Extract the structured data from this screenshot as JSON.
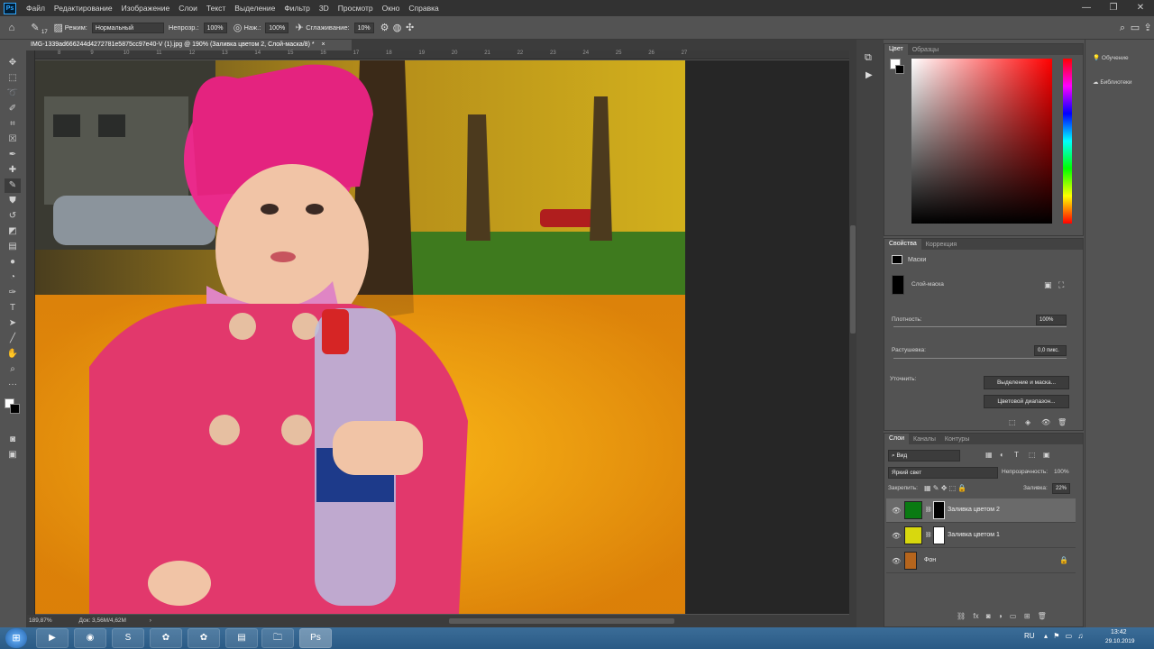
{
  "menubar": {
    "logo": "Ps",
    "items": [
      "Файл",
      "Редактирование",
      "Изображение",
      "Слои",
      "Текст",
      "Выделение",
      "Фильтр",
      "3D",
      "Просмотр",
      "Окно",
      "Справка"
    ]
  },
  "options": {
    "brush_size": "17",
    "mode_label": "Режим:",
    "mode_value": "Нормальный",
    "opacity_label": "Непрозр.:",
    "opacity_value": "100%",
    "pressure_label": "Наж.:",
    "pressure_value": "100%",
    "smoothing_label": "Сглаживание:",
    "smoothing_value": "10%"
  },
  "document": {
    "tab_title": "IMG-1339ad666244d4272781e5875cc97e40-V (1).jpg @ 190% (Заливка цветом 2, Слой-маска/8) *",
    "ruler_ticks": [
      "8",
      "9",
      "10",
      "11",
      "12",
      "13",
      "14",
      "15",
      "16",
      "17",
      "18",
      "19",
      "20",
      "21",
      "22",
      "23",
      "24",
      "25",
      "26",
      "27"
    ],
    "zoom": "189,87%",
    "doc_size": "Док: 3,56M/4,62M"
  },
  "color_panel": {
    "tabs": [
      "Цвет",
      "Образцы"
    ]
  },
  "properties_panel": {
    "tabs": [
      "Свойства",
      "Коррекция"
    ],
    "masks_label": "Маски",
    "layer_mask_label": "Слой-маска",
    "density_label": "Плотность:",
    "density_value": "100%",
    "feather_label": "Растушевка:",
    "feather_value": "0,0 пикс.",
    "refine_label": "Уточнить:",
    "select_mask_btn": "Выделение и маска...",
    "color_range_btn": "Цветовой диапазон..."
  },
  "layers_panel": {
    "tabs": [
      "Слои",
      "Каналы",
      "Контуры"
    ],
    "filter_value": "Вид",
    "blend_mode": "Яркий свет",
    "opacity_label": "Непрозрачность:",
    "opacity_value": "100%",
    "lock_label": "Закрепить:",
    "fill_label": "Заливка:",
    "fill_value": "22%",
    "layers": [
      {
        "name": "Заливка цветом 2",
        "color": "#0a7a12"
      },
      {
        "name": "Заливка цветом 1",
        "color": "#d8d80e"
      },
      {
        "name": "Фон",
        "color": "#b5651d"
      }
    ]
  },
  "right_dock": {
    "learn": "Обучение",
    "libraries": "Библиотеки"
  },
  "taskbar": {
    "lang": "RU",
    "time": "13:42",
    "date": "29.10.2019"
  }
}
